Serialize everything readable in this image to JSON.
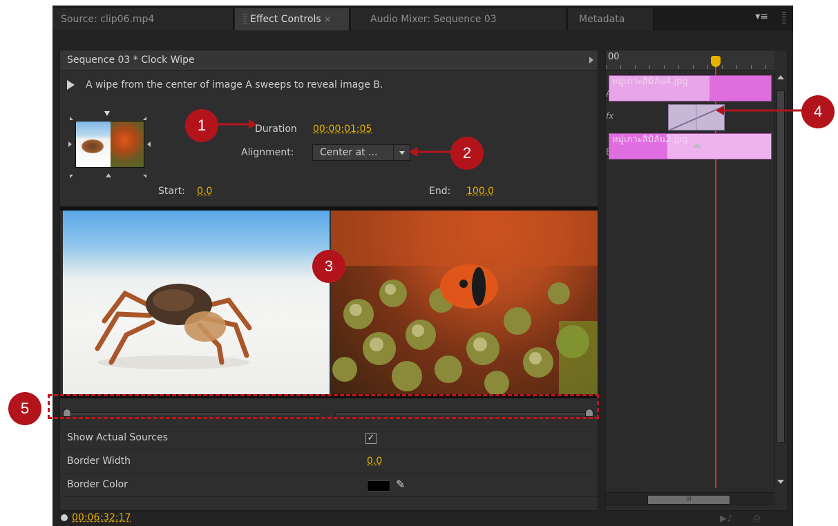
{
  "tabs": [
    {
      "label": "Source: clip06.mp4",
      "active": false
    },
    {
      "label": "Effect Controls",
      "active": true,
      "close": "×"
    },
    {
      "label": "Audio Mixer: Sequence 03",
      "active": false
    },
    {
      "label": "Metadata",
      "active": false
    }
  ],
  "panel_menu_icon": "≡",
  "header": {
    "title": "Sequence 03 * Clock Wipe"
  },
  "description": "A wipe from the center of image A sweeps to reveal image B.",
  "duration": {
    "label": "Duration",
    "value": "00:00:01:05"
  },
  "alignment": {
    "label": "Alignment:",
    "value": "Center at ..."
  },
  "start": {
    "label": "Start:",
    "value": "0.0"
  },
  "end": {
    "label": "End:",
    "value": "100.0"
  },
  "properties": {
    "show_actual_sources": {
      "label": "Show Actual Sources",
      "checked": true,
      "check": "✓"
    },
    "border_width": {
      "label": "Border Width",
      "value": "0.0"
    },
    "border_color": {
      "label": "Border Color",
      "color": "#000000",
      "icon": "eyedropper-icon"
    }
  },
  "timecode": "00:06:32:17",
  "timeline": {
    "ruler_start": "00",
    "track_a_letter": "A",
    "track_b_letter": "B",
    "fx_letter": "fx",
    "clip_a": "หมู่เกาะสิมิลัน4.jpg",
    "clip_b": "หมู่เกาะสิมิลัน2.jpg",
    "scroll_grip": "III"
  },
  "annotations": [
    "1",
    "2",
    "3",
    "4",
    "5"
  ],
  "colors": {
    "accent": "#e8b200",
    "annotation": "#b3141c",
    "clip": "#e07be0",
    "playhead": "#e03030"
  }
}
